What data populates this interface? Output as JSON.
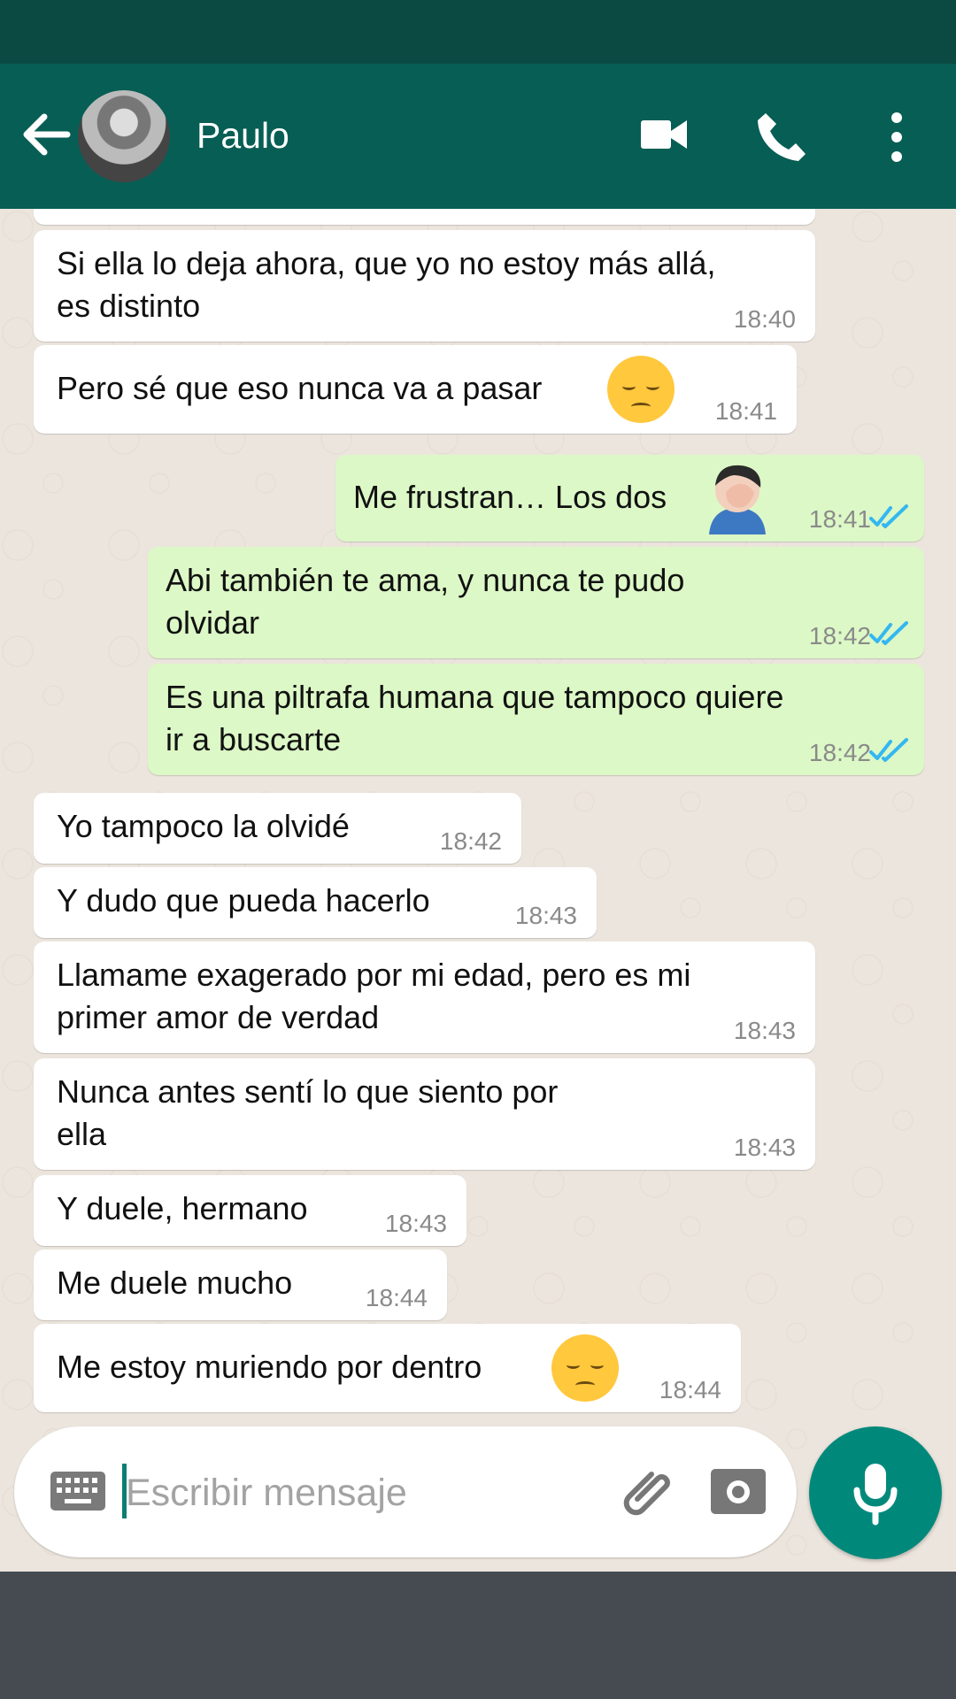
{
  "header": {
    "contact_name": "Paulo",
    "icons": [
      "back-arrow-icon",
      "avatar",
      "video-call-icon",
      "phone-icon",
      "more-vertical-icon"
    ]
  },
  "messages": [
    {
      "direction": "incoming",
      "text": "Si ella lo deja ahora, que yo no estoy más allá,\nes distinto",
      "time": "18:40"
    },
    {
      "direction": "incoming",
      "text": "Pero sé que eso nunca va a pasar",
      "emoji": "pensive-face",
      "time": "18:41"
    },
    {
      "direction": "outgoing",
      "text": "Me frustran… Los dos",
      "emoji": "man-facepalming",
      "time": "18:41",
      "read": true
    },
    {
      "direction": "outgoing",
      "text": "Abi también te ama, y nunca te pudo\nolvidar",
      "time": "18:42",
      "read": true
    },
    {
      "direction": "outgoing",
      "text": "Es una piltrafa humana que tampoco quiere\nir a buscarte",
      "time": "18:42",
      "read": true
    },
    {
      "direction": "incoming",
      "text": "Yo tampoco la olvidé",
      "time": "18:42"
    },
    {
      "direction": "incoming",
      "text": "Y dudo que pueda hacerlo",
      "time": "18:43"
    },
    {
      "direction": "incoming",
      "text": "Llamame exagerado por mi edad, pero es mi\nprimer amor de verdad",
      "time": "18:43"
    },
    {
      "direction": "incoming",
      "text": "Nunca antes sentí lo que siento por\nella",
      "time": "18:43"
    },
    {
      "direction": "incoming",
      "text": "Y duele, hermano",
      "time": "18:43"
    },
    {
      "direction": "incoming",
      "text": "Me duele mucho",
      "time": "18:44"
    },
    {
      "direction": "incoming",
      "text": "Me estoy muriendo por dentro",
      "emoji": "pensive-face",
      "time": "18:44"
    }
  ],
  "composer": {
    "placeholder": "Escribir mensaje",
    "icons": [
      "keyboard-icon",
      "attachment-icon",
      "camera-icon",
      "microphone-icon"
    ]
  },
  "colors": {
    "header": "#075e54",
    "status_bar": "#0a4a42",
    "incoming_bubble": "#ffffff",
    "outgoing_bubble": "#dcf8c6",
    "read_ticks": "#34b7f1",
    "mic_button": "#00897b",
    "navigation_bar": "#464b52"
  }
}
